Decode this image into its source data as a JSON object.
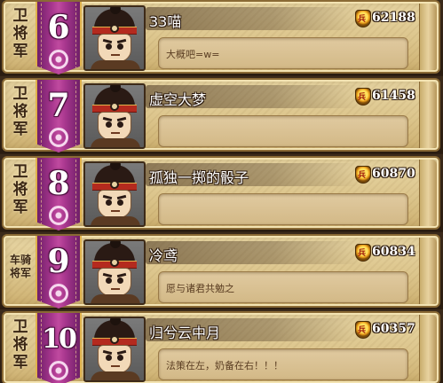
{
  "players": [
    {
      "rank_title": "卫将军",
      "rank": "6",
      "name": "33喵",
      "power": "62188",
      "message": "大概吧=w="
    },
    {
      "rank_title": "卫将军",
      "rank": "7",
      "name": "虚空大梦",
      "power": "61458",
      "message": ""
    },
    {
      "rank_title": "卫将军",
      "rank": "8",
      "name": "孤独一掷的骰子",
      "power": "60870",
      "message": ""
    },
    {
      "rank_title": "车骑将军",
      "rank": "9",
      "name": "冷鸢",
      "power": "60834",
      "message": "愿与诸君共勉之"
    },
    {
      "rank_title": "卫将军",
      "rank": "10",
      "name": "归兮云中月",
      "power": "60357",
      "message": "法策在左，奶备在右！！！"
    }
  ],
  "colors": {
    "banner": "#a9378f",
    "parchment": "#dcc58c",
    "name_text": "#ffffff"
  }
}
